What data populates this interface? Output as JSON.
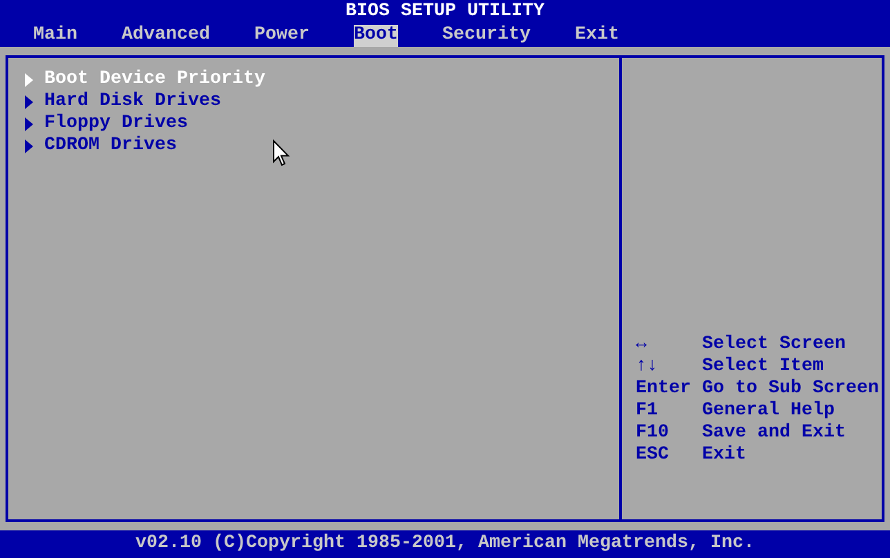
{
  "window": {
    "title": "BIOS SETUP UTILITY"
  },
  "tabs": [
    {
      "label": "Main",
      "selected": false
    },
    {
      "label": "Advanced",
      "selected": false
    },
    {
      "label": "Power",
      "selected": false
    },
    {
      "label": "Boot",
      "selected": true
    },
    {
      "label": "Security",
      "selected": false
    },
    {
      "label": "Exit",
      "selected": false
    }
  ],
  "menu_items": [
    {
      "label": "Boot Device Priority",
      "selected": true
    },
    {
      "label": "Hard Disk Drives",
      "selected": false
    },
    {
      "label": "Floppy Drives",
      "selected": false
    },
    {
      "label": "CDROM Drives",
      "selected": false
    }
  ],
  "key_help": [
    {
      "key": "↔",
      "action": "Select Screen"
    },
    {
      "key": "↑↓",
      "action": "Select Item"
    },
    {
      "key": "Enter",
      "action": "Go to Sub Screen"
    },
    {
      "key": "F1",
      "action": "General Help"
    },
    {
      "key": "F10",
      "action": "Save and Exit"
    },
    {
      "key": "ESC",
      "action": "Exit"
    }
  ],
  "status_bar": {
    "text": "v02.10 (C)Copyright 1985-2001, American Megatrends, Inc."
  }
}
